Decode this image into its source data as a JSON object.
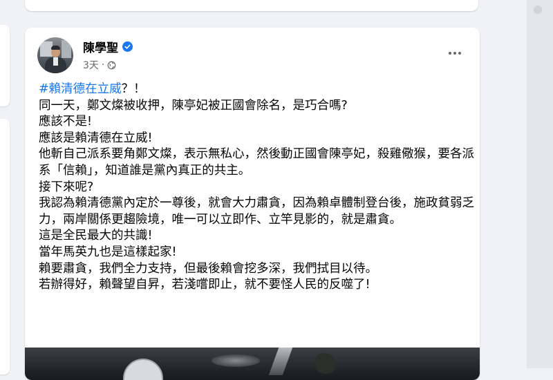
{
  "post": {
    "author": "陳學聖",
    "time": "3天",
    "separator": "·",
    "hashtag": "#賴清德在立威",
    "hashtag_suffix": "？！",
    "lines": [
      "同一天，鄭文燦被收押，陳亭妃被正國會除名，是巧合嗎?",
      "應該不是!",
      "應該是賴清德在立威!",
      "他斬自己派系要角鄭文燦，表示無私心，然後動正國會陳亭妃，殺雞儆猴，要各派系「信賴」，知道誰是黨內真正的共主。",
      "接下來呢?",
      "我認為賴清德黨內定於一尊後，就會大力肅貪，因為賴卓體制登台後，施政貧弱乏力，兩岸關係更趨險境，唯一可以立即作、立竿見影的，就是肅貪。",
      "這是全民最大的共識!",
      "當年馬英九也是這樣起家!",
      "賴要肅貪，我們全力支持，但最後賴會挖多深，我們拭目以待。",
      "若辦得好，賴聲望自昇，若淺嚐即止，就不要怪人民的反噬了!"
    ]
  },
  "icons": {
    "verified": "verified-badge-icon",
    "audience": "globe-icon",
    "more": "more-options-icon"
  },
  "colors": {
    "hashtag": "#1877f2",
    "verified": "#1877f2",
    "meta": "#65676b",
    "background": "#f0f2f5"
  }
}
